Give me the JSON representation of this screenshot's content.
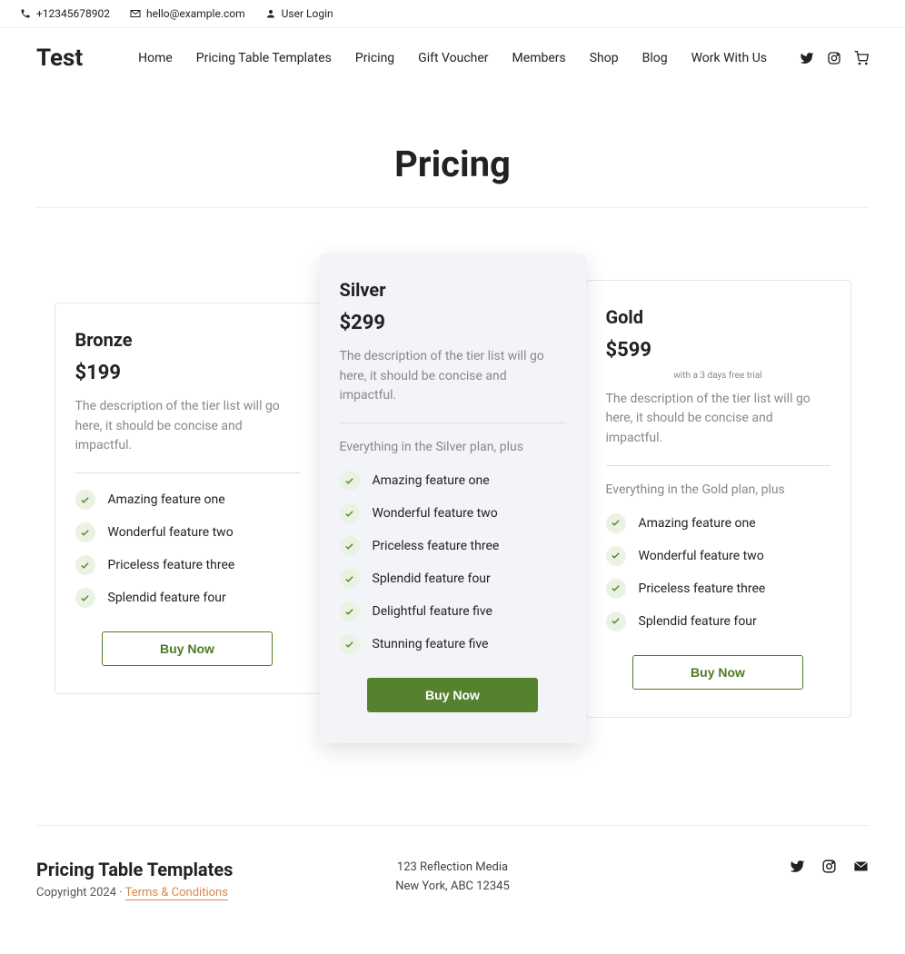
{
  "topbar": {
    "phone": "+12345678902",
    "email": "hello@example.com",
    "login": "User Login"
  },
  "header": {
    "logo": "Test",
    "nav": [
      "Home",
      "Pricing Table Templates",
      "Pricing",
      "Gift Voucher",
      "Members",
      "Shop",
      "Blog",
      "Work With Us"
    ]
  },
  "page": {
    "title": "Pricing"
  },
  "plans": [
    {
      "name": "Bronze",
      "price": "$199",
      "badge": "",
      "desc": "The description of the tier list will go here, it should be concise and impactful.",
      "sub": "",
      "features": [
        "Amazing feature one",
        "Wonderful feature two",
        "Priceless feature three",
        "Splendid feature four"
      ],
      "cta": "Buy Now",
      "featured": false
    },
    {
      "name": "Silver",
      "price": "$299",
      "badge": "",
      "desc": "The description of the tier list will go here, it should be concise and impactful.",
      "sub": "Everything in the Silver plan, plus",
      "features": [
        "Amazing feature one",
        "Wonderful feature two",
        "Priceless feature three",
        "Splendid feature four",
        "Delightful feature five",
        "Stunning feature five"
      ],
      "cta": "Buy Now",
      "featured": true
    },
    {
      "name": "Gold",
      "price": "$599",
      "badge": "with a 3 days free trial",
      "desc": "The description of the tier list will go here, it should be concise and impactful.",
      "sub": "Everything in the Gold plan, plus",
      "features": [
        "Amazing feature one",
        "Wonderful feature two",
        "Priceless feature three",
        "Splendid feature four"
      ],
      "cta": "Buy Now",
      "featured": false
    }
  ],
  "footer": {
    "title": "Pricing Table Templates",
    "copyright": "Copyright 2024 · ",
    "terms": "Terms & Conditions",
    "addr1": "123 Reflection Media",
    "addr2": "New York, ABC 12345"
  }
}
